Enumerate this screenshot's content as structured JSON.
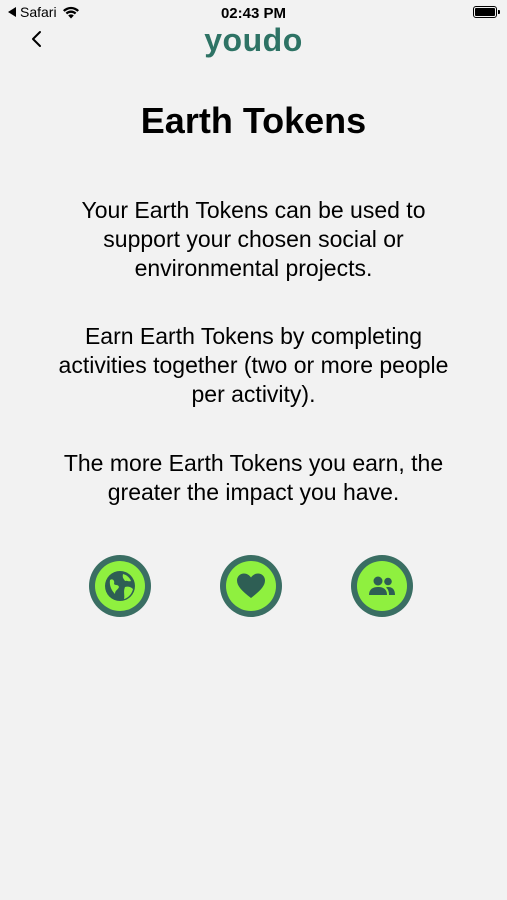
{
  "status_bar": {
    "back_app": "Safari",
    "time": "02:43 PM"
  },
  "header": {
    "logo_text": "youdo"
  },
  "page": {
    "title": "Earth Tokens",
    "paragraphs": [
      "Your Earth Tokens can be used to support your chosen social or environmental projects.",
      "Earn Earth Tokens by completing activities together (two or more people per activity).",
      "The more Earth Tokens you earn, the greater the impact you have."
    ]
  },
  "icons": [
    "globe-icon",
    "heart-icon",
    "people-icon"
  ],
  "colors": {
    "background": "#f2f2f2",
    "brand_teal": "#2e7365",
    "icon_ring": "#3a6e63",
    "icon_fill": "#8ff03f"
  }
}
